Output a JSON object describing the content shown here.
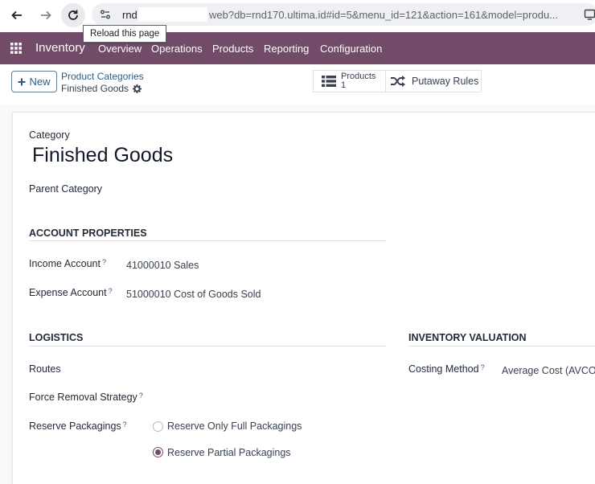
{
  "browser": {
    "url_prefix": "rnd",
    "url_rest": "web?db=rnd170.ultima.id#id=5&menu_id=121&action=161&model=produ...",
    "tooltip": "Reload this page"
  },
  "nav": {
    "app": "Inventory",
    "menu": [
      "Overview",
      "Operations",
      "Products",
      "Reporting",
      "Configuration"
    ]
  },
  "control_panel": {
    "new_label": "New",
    "breadcrumb_parent": "Product Categories",
    "breadcrumb_current": "Finished Goods",
    "smart_products_label": "Products",
    "smart_products_count": "1",
    "putaway_label": "Putaway Rules"
  },
  "form": {
    "category_label": "Category",
    "category_name": "Finished Goods",
    "parent_category_label": "Parent Category",
    "account_properties": {
      "title": "ACCOUNT PROPERTIES",
      "income_label": "Income Account",
      "income_value": "41000010 Sales",
      "expense_label": "Expense Account",
      "expense_value": "51000010 Cost of Goods Sold"
    },
    "logistics": {
      "title": "LOGISTICS",
      "routes_label": "Routes",
      "removal_label": "Force Removal Strategy",
      "packagings_label": "Reserve Packagings",
      "option_full": "Reserve Only Full Packagings",
      "option_partial": "Reserve Partial Packagings",
      "selected": "Reserve Partial Packagings"
    },
    "inventory_valuation": {
      "title": "INVENTORY VALUATION",
      "costing_label": "Costing Method",
      "costing_value": "Average Cost (AVCO)"
    },
    "help_mark": "?"
  },
  "colors": {
    "brand": "#714b67",
    "link": "#2f5b84"
  }
}
